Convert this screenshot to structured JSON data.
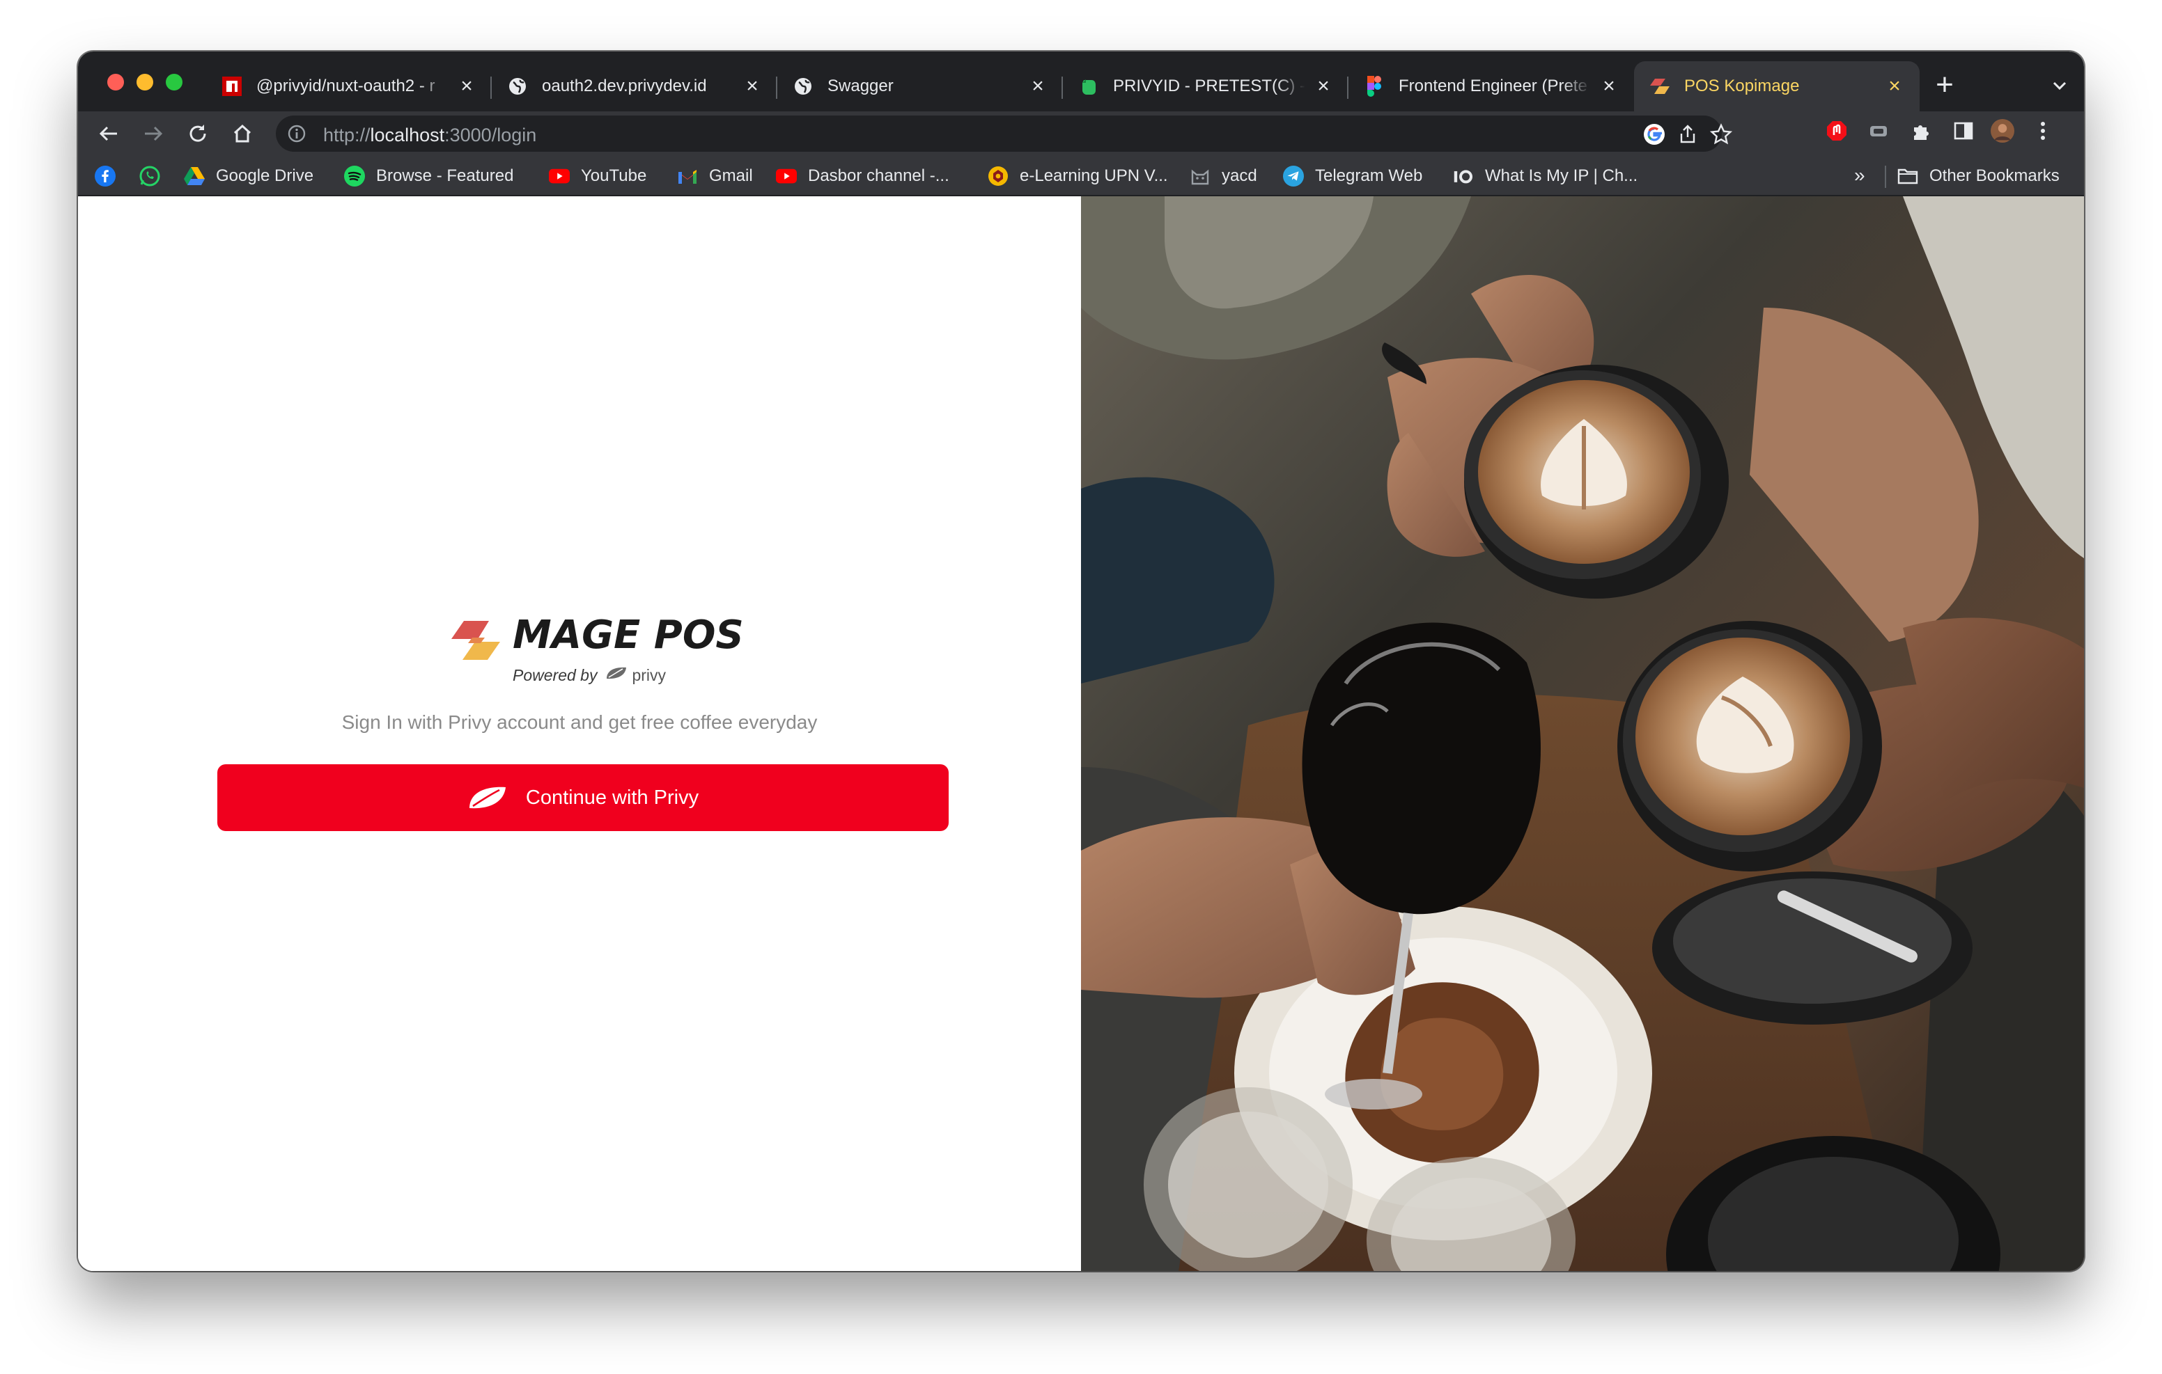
{
  "browser": {
    "tabs": [
      {
        "title": "@privyid/nuxt-oauth2 - r",
        "favicon": "npm-icon",
        "active": false
      },
      {
        "title": "oauth2.dev.privydev.id",
        "favicon": "globe-icon",
        "active": false
      },
      {
        "title": "Swagger",
        "favicon": "globe-icon",
        "active": false
      },
      {
        "title": "PRIVYID - PRETEST(C) - E",
        "favicon": "evernote-icon",
        "active": false
      },
      {
        "title": "Frontend Engineer (Prete",
        "favicon": "figma-icon",
        "active": false
      },
      {
        "title": "POS Kopimage",
        "favicon": "mage-pos-icon",
        "active": true
      }
    ],
    "address": {
      "scheme": "http://",
      "host": "localhost",
      "rest": ":3000/login"
    },
    "bookmarks": [
      {
        "label": "",
        "icon": "facebook-icon"
      },
      {
        "label": "",
        "icon": "whatsapp-icon"
      },
      {
        "label": "Google Drive",
        "icon": "google-drive-icon"
      },
      {
        "label": "Browse - Featured",
        "icon": "spotify-icon"
      },
      {
        "label": "YouTube",
        "icon": "youtube-icon"
      },
      {
        "label": "Gmail",
        "icon": "gmail-icon"
      },
      {
        "label": "Dasbor channel -...",
        "icon": "youtube-icon"
      },
      {
        "label": "e-Learning UPN V...",
        "icon": "upn-icon"
      },
      {
        "label": "yacd",
        "icon": "cat-icon"
      },
      {
        "label": "Telegram Web",
        "icon": "telegram-icon"
      },
      {
        "label": "What Is My IP | Ch...",
        "icon": "ip-icon"
      }
    ],
    "bookmarks_more": "»",
    "other_bookmarks": "Other Bookmarks"
  },
  "login": {
    "brand_name": "MAGE POS",
    "powered_by": "Powered by",
    "privy_word": "privy",
    "tagline": "Sign In with Privy account and get free coffee everyday",
    "cta_label": "Continue with Privy"
  },
  "colors": {
    "cta": "#f0001e",
    "brand_text": "#1b1b1b",
    "active_tab_text": "#fbd663",
    "chrome_dark": "#202124",
    "chrome_toolbar": "#35363a"
  }
}
